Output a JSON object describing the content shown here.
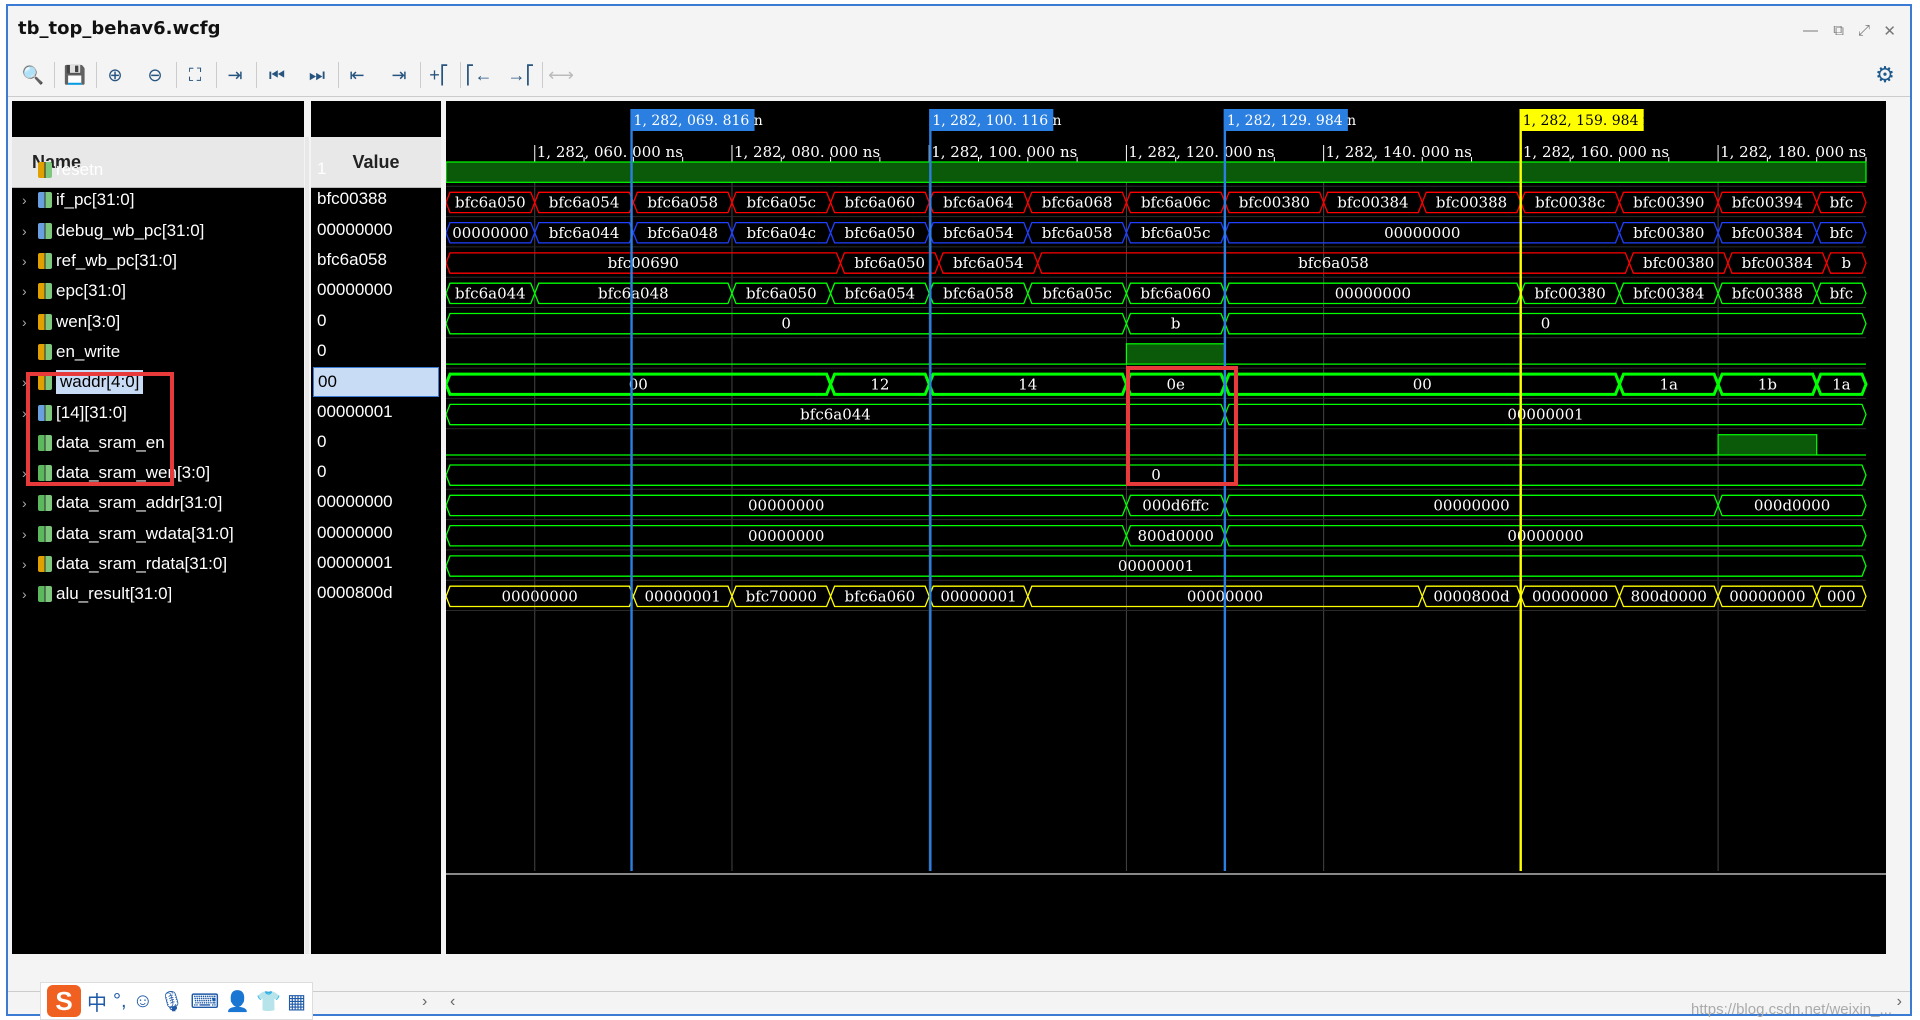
{
  "window": {
    "title": "tb_top_behav6.wcfg"
  },
  "toolbar": {
    "buttons": [
      {
        "name": "search-icon",
        "glyph": "🔍"
      },
      {
        "name": "save-icon",
        "glyph": "💾"
      },
      {
        "name": "zoom-in-icon",
        "glyph": "⊕"
      },
      {
        "name": "zoom-out-icon",
        "glyph": "⊖"
      },
      {
        "name": "zoom-fit-icon",
        "glyph": "⛶"
      },
      {
        "name": "go-to-cursor-icon",
        "glyph": "⇥"
      },
      {
        "name": "go-to-time-zero-icon",
        "glyph": "⏮"
      },
      {
        "name": "go-to-last-time-icon",
        "glyph": "⏭"
      },
      {
        "name": "previous-transition-icon",
        "glyph": "⇤"
      },
      {
        "name": "next-transition-icon",
        "glyph": "⇥"
      },
      {
        "name": "add-marker-icon",
        "glyph": "+⎡"
      },
      {
        "name": "previous-marker-icon",
        "glyph": "⎡←"
      },
      {
        "name": "next-marker-icon",
        "glyph": "→⎡"
      },
      {
        "name": "swap-cursors-icon",
        "glyph": "⟷"
      }
    ]
  },
  "columns": {
    "name": "Name",
    "value": "Value"
  },
  "signals": [
    {
      "name": "resetn",
      "value": "1",
      "expandable": false,
      "icon_color": "#e0a000"
    },
    {
      "name": "if_pc[31:0]",
      "value": "bfc00388",
      "expandable": true,
      "icon_color": "#6aa0e0"
    },
    {
      "name": "debug_wb_pc[31:0]",
      "value": "00000000",
      "expandable": true,
      "icon_color": "#6aa0e0"
    },
    {
      "name": "ref_wb_pc[31:0]",
      "value": "bfc6a058",
      "expandable": true,
      "icon_color": "#e0a000"
    },
    {
      "name": "epc[31:0]",
      "value": "00000000",
      "expandable": true,
      "icon_color": "#e0a000"
    },
    {
      "name": "wen[3:0]",
      "value": "0",
      "expandable": true,
      "icon_color": "#e0a000"
    },
    {
      "name": "en_write",
      "value": "0",
      "expandable": false,
      "icon_color": "#e0a000"
    },
    {
      "name": "waddr[4:0]",
      "value": "00",
      "expandable": true,
      "icon_color": "#e0a000",
      "selected": true
    },
    {
      "name": "[14][31:0]",
      "value": "00000001",
      "expandable": true,
      "icon_color": "#6aa0e0"
    },
    {
      "name": "data_sram_en",
      "value": "0",
      "expandable": false,
      "icon_color": "#5cb85c"
    },
    {
      "name": "data_sram_wen[3:0]",
      "value": "0",
      "expandable": true,
      "icon_color": "#5cb85c"
    },
    {
      "name": "data_sram_addr[31:0]",
      "value": "00000000",
      "expandable": true,
      "icon_color": "#5cb85c"
    },
    {
      "name": "data_sram_wdata[31:0]",
      "value": "00000000",
      "expandable": true,
      "icon_color": "#5cb85c"
    },
    {
      "name": "data_sram_rdata[31:0]",
      "value": "00000001",
      "expandable": true,
      "icon_color": "#e0a000"
    },
    {
      "name": "alu_result[31:0]",
      "value": "0000800d",
      "expandable": true,
      "icon_color": "#5cb85c"
    }
  ],
  "cursors": [
    {
      "label": "1, 282, 069. 816 n",
      "time": 1282069.816,
      "color": "#2a7fe0"
    },
    {
      "label": "1, 282, 100. 116 n",
      "time": 1282100.116,
      "color": "#2a7fe0"
    },
    {
      "label": "1, 282, 129. 984 n",
      "time": 1282129.984,
      "color": "#2a7fe0"
    },
    {
      "label": "1, 282, 159. 984 n",
      "time": 1282159.984,
      "color": "#ffff00",
      "main": true
    }
  ],
  "ruler": {
    "ticks": [
      {
        "label": "1, 282, 060. 000  ns",
        "time": 1282060
      },
      {
        "label": "1, 282, 080. 000  ns",
        "time": 1282080
      },
      {
        "label": "1, 282, 100. 000  ns",
        "time": 1282100
      },
      {
        "label": "1, 282, 120. 000  ns",
        "time": 1282120
      },
      {
        "label": "1, 282, 140. 000  ns",
        "time": 1282140
      },
      {
        "label": "1, 282, 160. 000  ns",
        "time": 1282160
      },
      {
        "label": "1, 282, 180. 000  ns",
        "time": 1282180
      }
    ]
  },
  "waves": {
    "t_start": 1282051,
    "t_end": 1282195,
    "rows": [
      {
        "type": "bit",
        "color": "#00ff00",
        "segs": [
          {
            "t0": 1282051,
            "t1": 1282195,
            "v": 1
          }
        ]
      },
      {
        "type": "bus",
        "color": "#ff0000",
        "segs": [
          {
            "t0": 1282051,
            "t1": 1282060,
            "v": "bfc6a050"
          },
          {
            "t0": 1282060,
            "t1": 1282070,
            "v": "bfc6a054"
          },
          {
            "t0": 1282070,
            "t1": 1282080,
            "v": "bfc6a058"
          },
          {
            "t0": 1282080,
            "t1": 1282090,
            "v": "bfc6a05c"
          },
          {
            "t0": 1282090,
            "t1": 1282100,
            "v": "bfc6a060"
          },
          {
            "t0": 1282100,
            "t1": 1282110,
            "v": "bfc6a064"
          },
          {
            "t0": 1282110,
            "t1": 1282120,
            "v": "bfc6a068"
          },
          {
            "t0": 1282120,
            "t1": 1282130,
            "v": "bfc6a06c"
          },
          {
            "t0": 1282130,
            "t1": 1282140,
            "v": "bfc00380"
          },
          {
            "t0": 1282140,
            "t1": 1282150,
            "v": "bfc00384"
          },
          {
            "t0": 1282150,
            "t1": 1282160,
            "v": "bfc00388"
          },
          {
            "t0": 1282160,
            "t1": 1282170,
            "v": "bfc0038c"
          },
          {
            "t0": 1282170,
            "t1": 1282180,
            "v": "bfc00390"
          },
          {
            "t0": 1282180,
            "t1": 1282190,
            "v": "bfc00394"
          },
          {
            "t0": 1282190,
            "t1": 1282195,
            "v": "bfc"
          }
        ]
      },
      {
        "type": "bus",
        "color": "#2040ff",
        "segs": [
          {
            "t0": 1282051,
            "t1": 1282060,
            "v": "00000000"
          },
          {
            "t0": 1282060,
            "t1": 1282070,
            "v": "bfc6a044"
          },
          {
            "t0": 1282070,
            "t1": 1282080,
            "v": "bfc6a048"
          },
          {
            "t0": 1282080,
            "t1": 1282090,
            "v": "bfc6a04c"
          },
          {
            "t0": 1282090,
            "t1": 1282100,
            "v": "bfc6a050"
          },
          {
            "t0": 1282100,
            "t1": 1282110,
            "v": "bfc6a054"
          },
          {
            "t0": 1282110,
            "t1": 1282120,
            "v": "bfc6a058"
          },
          {
            "t0": 1282120,
            "t1": 1282130,
            "v": "bfc6a05c"
          },
          {
            "t0": 1282130,
            "t1": 1282170,
            "v": "00000000"
          },
          {
            "t0": 1282170,
            "t1": 1282180,
            "v": "bfc00380"
          },
          {
            "t0": 1282180,
            "t1": 1282190,
            "v": "bfc00384"
          },
          {
            "t0": 1282190,
            "t1": 1282195,
            "v": "bfc"
          }
        ]
      },
      {
        "type": "bus",
        "color": "#ff0000",
        "segs": [
          {
            "t0": 1282051,
            "t1": 1282091,
            "v": "bfc00690"
          },
          {
            "t0": 1282091,
            "t1": 1282101,
            "v": "bfc6a050"
          },
          {
            "t0": 1282101,
            "t1": 1282111,
            "v": "bfc6a054"
          },
          {
            "t0": 1282111,
            "t1": 1282171,
            "v": "bfc6a058"
          },
          {
            "t0": 1282171,
            "t1": 1282181,
            "v": "bfc00380"
          },
          {
            "t0": 1282181,
            "t1": 1282191,
            "v": "bfc00384"
          },
          {
            "t0": 1282191,
            "t1": 1282195,
            "v": "b"
          }
        ]
      },
      {
        "type": "bus",
        "color": "#00ff00",
        "segs": [
          {
            "t0": 1282051,
            "t1": 1282060,
            "v": "bfc6a044"
          },
          {
            "t0": 1282060,
            "t1": 1282080,
            "v": "bfc6a048"
          },
          {
            "t0": 1282080,
            "t1": 1282090,
            "v": "bfc6a050"
          },
          {
            "t0": 1282090,
            "t1": 1282100,
            "v": "bfc6a054"
          },
          {
            "t0": 1282100,
            "t1": 1282110,
            "v": "bfc6a058"
          },
          {
            "t0": 1282110,
            "t1": 1282120,
            "v": "bfc6a05c"
          },
          {
            "t0": 1282120,
            "t1": 1282130,
            "v": "bfc6a060"
          },
          {
            "t0": 1282130,
            "t1": 1282160,
            "v": "00000000"
          },
          {
            "t0": 1282160,
            "t1": 1282170,
            "v": "bfc00380"
          },
          {
            "t0": 1282170,
            "t1": 1282180,
            "v": "bfc00384"
          },
          {
            "t0": 1282180,
            "t1": 1282190,
            "v": "bfc00388"
          },
          {
            "t0": 1282190,
            "t1": 1282195,
            "v": "bfc"
          }
        ]
      },
      {
        "type": "bus",
        "color": "#00ff00",
        "segs": [
          {
            "t0": 1282051,
            "t1": 1282120,
            "v": "0"
          },
          {
            "t0": 1282120,
            "t1": 1282130,
            "v": "b"
          },
          {
            "t0": 1282130,
            "t1": 1282195,
            "v": "0"
          }
        ]
      },
      {
        "type": "bit",
        "color": "#00ff00",
        "segs": [
          {
            "t0": 1282051,
            "t1": 1282120,
            "v": 0
          },
          {
            "t0": 1282120,
            "t1": 1282130,
            "v": 1
          },
          {
            "t0": 1282130,
            "t1": 1282195,
            "v": 0
          }
        ]
      },
      {
        "type": "bus",
        "color": "#00ff00",
        "thick": true,
        "segs": [
          {
            "t0": 1282051,
            "t1": 1282090,
            "v": "00"
          },
          {
            "t0": 1282090,
            "t1": 1282100,
            "v": "12"
          },
          {
            "t0": 1282100,
            "t1": 1282120,
            "v": "14"
          },
          {
            "t0": 1282120,
            "t1": 1282130,
            "v": "0e"
          },
          {
            "t0": 1282130,
            "t1": 1282170,
            "v": "00"
          },
          {
            "t0": 1282170,
            "t1": 1282180,
            "v": "1a"
          },
          {
            "t0": 1282180,
            "t1": 1282190,
            "v": "1b"
          },
          {
            "t0": 1282190,
            "t1": 1282195,
            "v": "1a"
          }
        ]
      },
      {
        "type": "bus",
        "color": "#00ff00",
        "segs": [
          {
            "t0": 1282051,
            "t1": 1282130,
            "v": "bfc6a044"
          },
          {
            "t0": 1282130,
            "t1": 1282195,
            "v": "00000001"
          }
        ]
      },
      {
        "type": "bit",
        "color": "#00ff00",
        "segs": [
          {
            "t0": 1282051,
            "t1": 1282180,
            "v": 0
          },
          {
            "t0": 1282180,
            "t1": 1282190,
            "v": 1
          },
          {
            "t0": 1282190,
            "t1": 1282195,
            "v": 0
          }
        ]
      },
      {
        "type": "bus",
        "color": "#00ff00",
        "segs": [
          {
            "t0": 1282051,
            "t1": 1282195,
            "v": "0"
          }
        ]
      },
      {
        "type": "bus",
        "color": "#00ff00",
        "segs": [
          {
            "t0": 1282051,
            "t1": 1282120,
            "v": "00000000"
          },
          {
            "t0": 1282120,
            "t1": 1282130,
            "v": "000d6ffc"
          },
          {
            "t0": 1282130,
            "t1": 1282180,
            "v": "00000000"
          },
          {
            "t0": 1282180,
            "t1": 1282195,
            "v": "000d0000"
          }
        ]
      },
      {
        "type": "bus",
        "color": "#00ff00",
        "segs": [
          {
            "t0": 1282051,
            "t1": 1282120,
            "v": "00000000"
          },
          {
            "t0": 1282120,
            "t1": 1282130,
            "v": "800d0000"
          },
          {
            "t0": 1282130,
            "t1": 1282195,
            "v": "00000000"
          }
        ]
      },
      {
        "type": "bus",
        "color": "#00ff00",
        "segs": [
          {
            "t0": 1282051,
            "t1": 1282195,
            "v": "00000001"
          }
        ]
      },
      {
        "type": "bus",
        "color": "#ffff00",
        "segs": [
          {
            "t0": 1282051,
            "t1": 1282070,
            "v": "00000000"
          },
          {
            "t0": 1282070,
            "t1": 1282080,
            "v": "00000001"
          },
          {
            "t0": 1282080,
            "t1": 1282090,
            "v": "bfc70000"
          },
          {
            "t0": 1282090,
            "t1": 1282100,
            "v": "bfc6a060"
          },
          {
            "t0": 1282100,
            "t1": 1282110,
            "v": "00000001"
          },
          {
            "t0": 1282110,
            "t1": 1282150,
            "v": "00000000"
          },
          {
            "t0": 1282150,
            "t1": 1282160,
            "v": "0000800d"
          },
          {
            "t0": 1282160,
            "t1": 1282170,
            "v": "00000000"
          },
          {
            "t0": 1282170,
            "t1": 1282180,
            "v": "800d0000"
          },
          {
            "t0": 1282180,
            "t1": 1282190,
            "v": "00000000"
          },
          {
            "t0": 1282190,
            "t1": 1282195,
            "v": "000"
          }
        ]
      }
    ]
  },
  "watermark": "https://blog.csdn.net/weixin_..."
}
